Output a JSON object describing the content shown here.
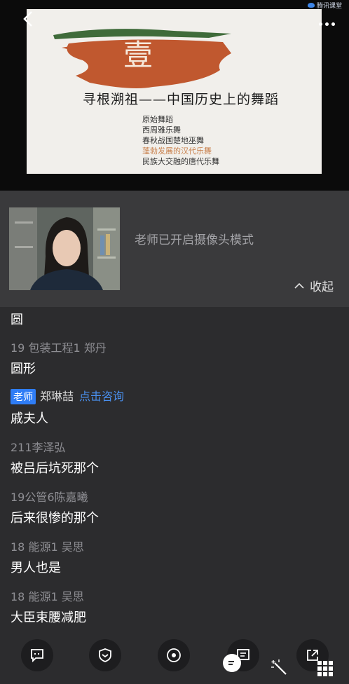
{
  "watermark": "腾讯课堂",
  "icons": {
    "back": "chevron-left-icon",
    "more": "more-dots-icon",
    "chat": "chat-bubble-icon",
    "badge": "shield-icon",
    "record": "record-icon",
    "notes": "notes-icon",
    "share": "share-icon",
    "wand": "magic-wand-icon",
    "grid": "grid-icon"
  },
  "colors": {
    "accent": "#2f7df6",
    "brush": "#c0582f",
    "highlight": "#c9824f"
  },
  "slide": {
    "number_char": "壹",
    "title": "寻根溯祖——中国历史上的舞蹈",
    "outline": [
      {
        "text": "原始舞蹈",
        "highlight": false
      },
      {
        "text": "西周雅乐舞",
        "highlight": false
      },
      {
        "text": "春秋战国楚地巫舞",
        "highlight": false
      },
      {
        "text": "蓬勃发展的汉代乐舞",
        "highlight": true
      },
      {
        "text": "民族大交融的唐代乐舞",
        "highlight": false
      }
    ]
  },
  "camera": {
    "status": "老师已开启摄像头模式",
    "collapse_label": "收起"
  },
  "chat": {
    "first_text": "圆",
    "messages": [
      {
        "name": "19 包装工程1 郑丹",
        "text": "圆形"
      },
      {
        "teacher_badge": "老师",
        "teacher_name": "郑琳喆",
        "consult": "点击咨询",
        "text": "戚夫人"
      },
      {
        "name": "211李泽弘",
        "text": "被吕后坑死那个"
      },
      {
        "name": "19公管6陈嘉曦",
        "text": "后来很惨的那个"
      },
      {
        "name": "18 能源1 吴思",
        "text": "男人也是"
      },
      {
        "name": "18 能源1 吴思",
        "text": "大臣束腰减肥"
      }
    ]
  }
}
